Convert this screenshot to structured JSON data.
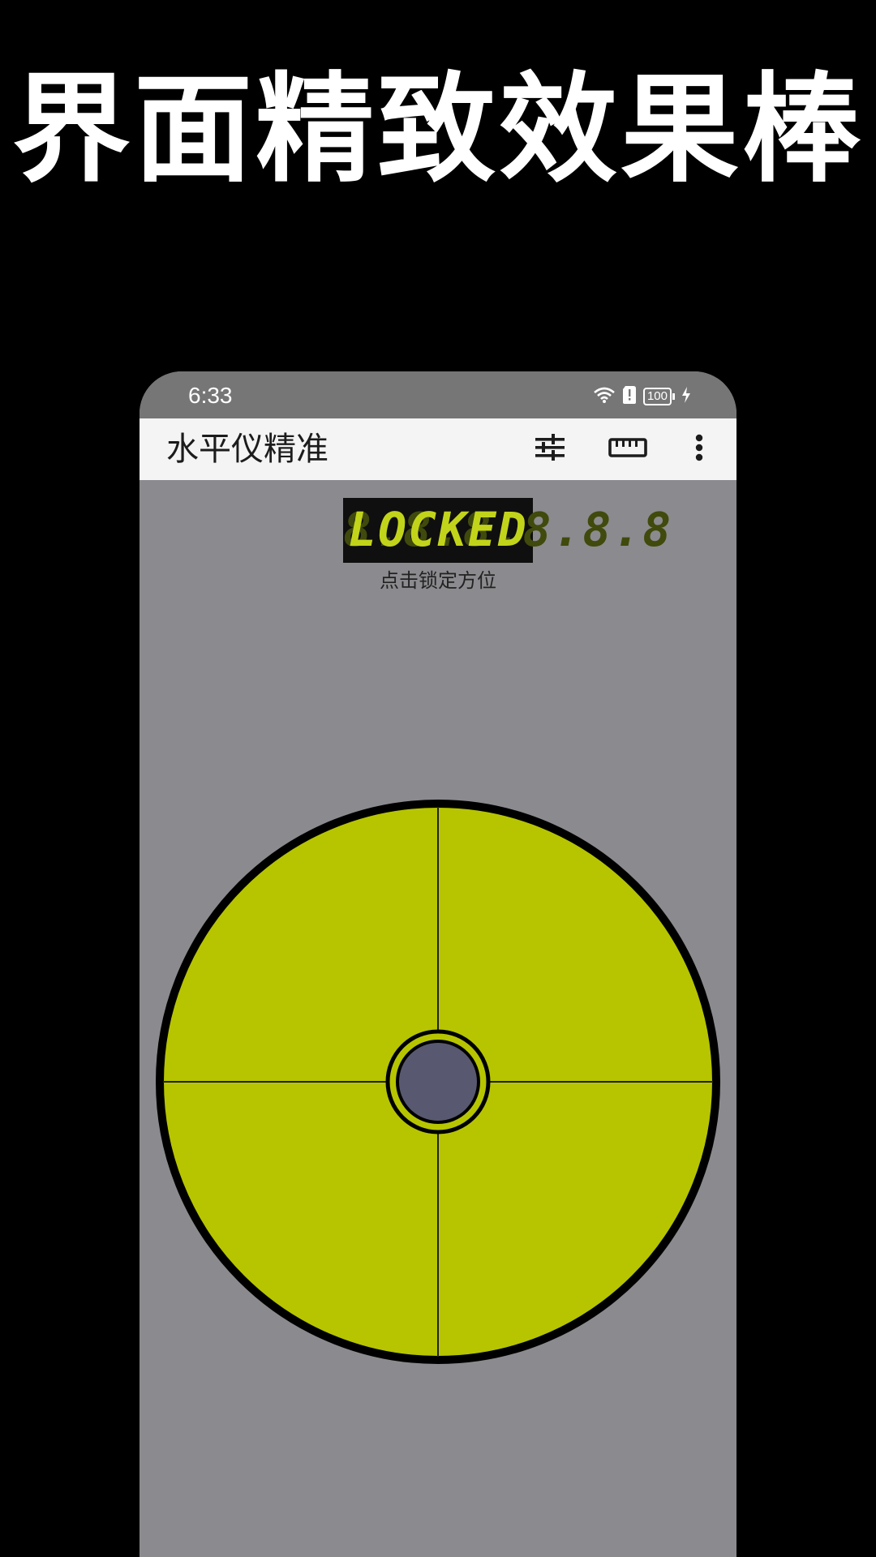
{
  "headline": "界面精致效果棒",
  "status_bar": {
    "time": "6:33",
    "battery": "100",
    "icons": [
      "wifi-icon",
      "sim-alert-icon",
      "battery-icon",
      "charging-icon"
    ]
  },
  "app_bar": {
    "title": "水平仪精准",
    "actions": [
      "tune-icon",
      "ruler-icon",
      "more-vert-icon"
    ]
  },
  "lcd": {
    "ghost": "8.8.8.8.8.8",
    "text": "LOCKED"
  },
  "lock_hint": "点击锁定方位",
  "level": {
    "bubble_offset_x": 0,
    "bubble_offset_y": 0
  },
  "colors": {
    "background": "#000000",
    "screen": "#8b8a8e",
    "status_bar": "#767676",
    "app_bar": "#f4f4f4",
    "level_fill": "#b6c500",
    "bubble": "#585870",
    "lcd_text": "#c2d41a"
  }
}
